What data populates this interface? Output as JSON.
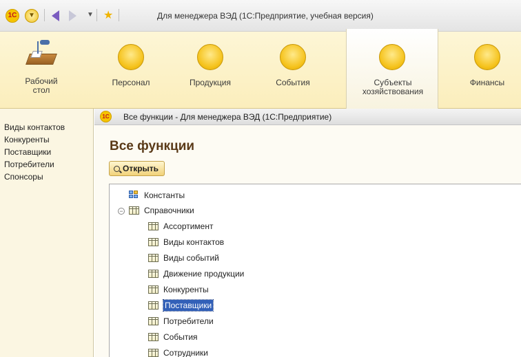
{
  "window": {
    "title": "Для менеджера ВЭД  (1С:Предприятие, учебная версия)",
    "logo_text": "1С"
  },
  "sections": [
    {
      "label": "Рабочий стол",
      "icon": "desk-icon",
      "active": false
    },
    {
      "label": "Персонал",
      "icon": "section-icon",
      "active": false
    },
    {
      "label": "Продукция",
      "icon": "section-icon",
      "active": false
    },
    {
      "label": "События",
      "icon": "section-icon",
      "active": false
    },
    {
      "label": "Субъекты хозяйствования",
      "icon": "section-icon",
      "active": true
    },
    {
      "label": "Финансы",
      "icon": "section-icon",
      "active": false
    }
  ],
  "leftnav": {
    "items": [
      "Виды контактов",
      "Конкуренты",
      "Поставщики",
      "Потребители",
      "Спонсоры"
    ]
  },
  "subwindow": {
    "title": "Все функции - Для менеджера ВЭД  (1С:Предприятие)",
    "heading": "Все функции",
    "open_button": "Открыть"
  },
  "tree": {
    "constants": "Константы",
    "catalogs": "Справочники",
    "items": [
      {
        "label": "Ассортимент",
        "selected": false
      },
      {
        "label": "Виды контактов",
        "selected": false
      },
      {
        "label": "Виды событий",
        "selected": false
      },
      {
        "label": "Движение продукции",
        "selected": false
      },
      {
        "label": "Конкуренты",
        "selected": false
      },
      {
        "label": "Поставщики",
        "selected": true
      },
      {
        "label": "Потребители",
        "selected": false
      },
      {
        "label": "События",
        "selected": false
      },
      {
        "label": "Сотрудники",
        "selected": false
      }
    ]
  },
  "colors": {
    "section_bg": "#fbeebc",
    "selection": "#3260b8",
    "heading": "#5a3a18"
  }
}
